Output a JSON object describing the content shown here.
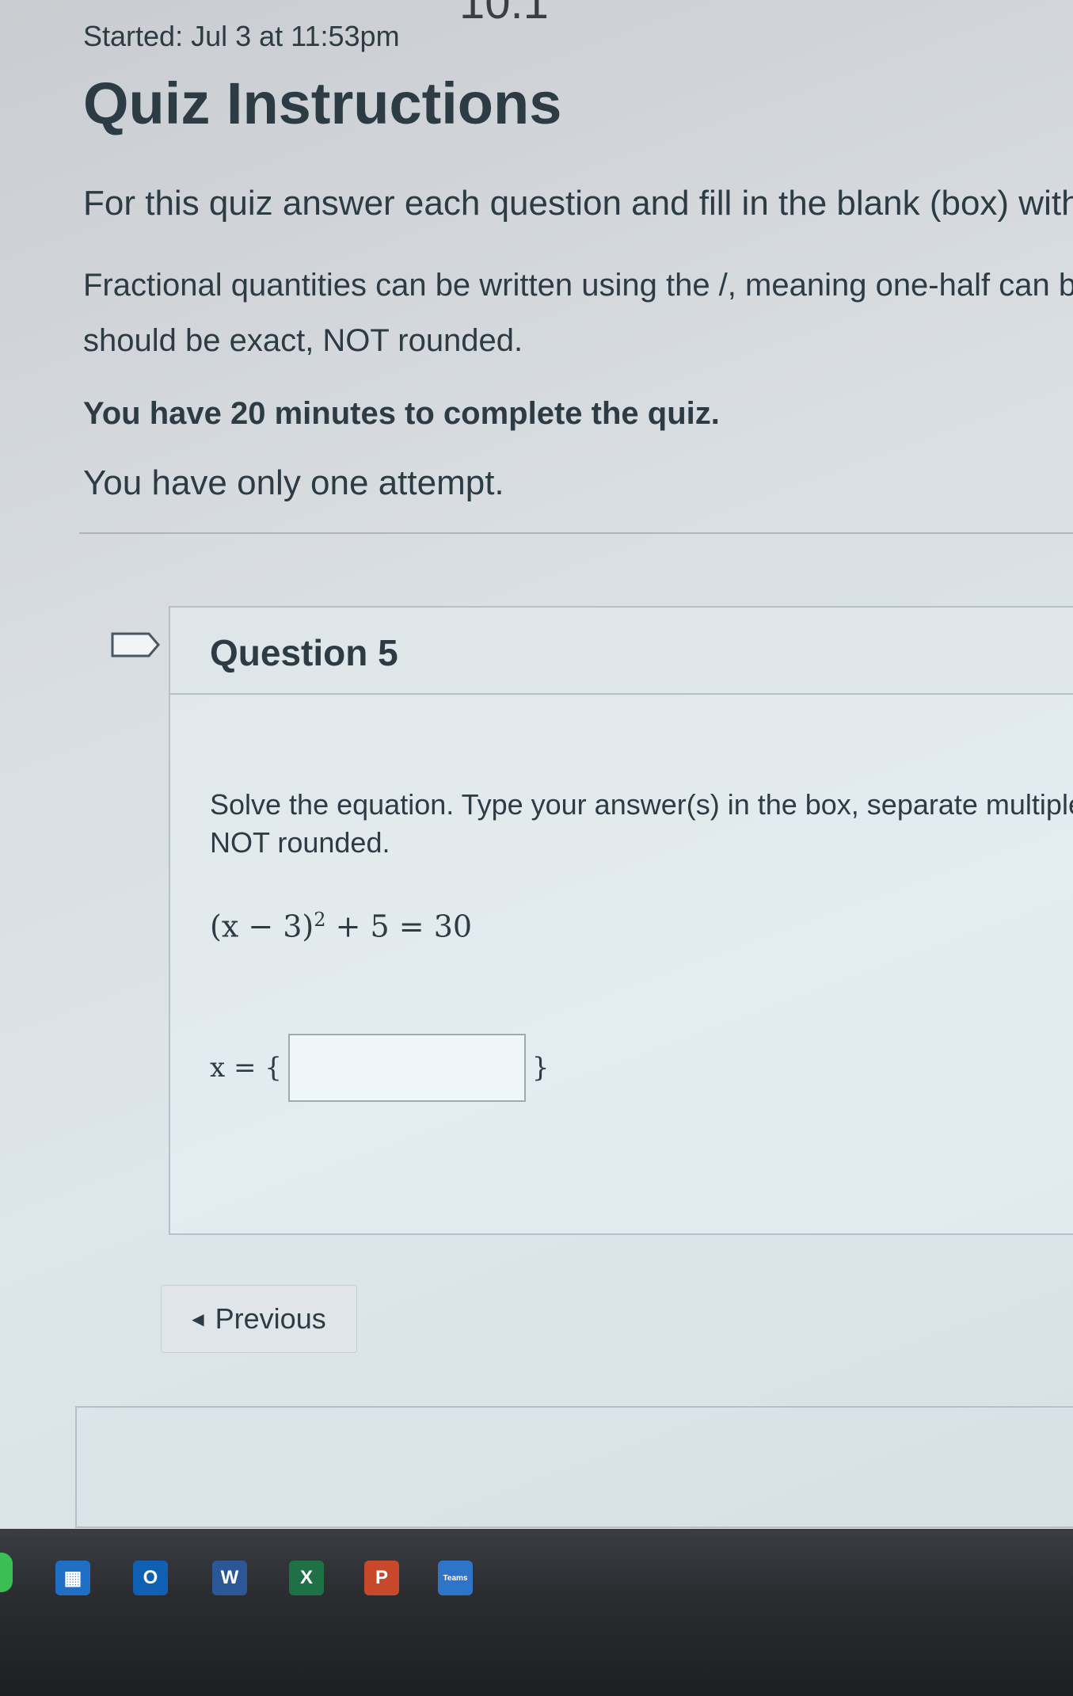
{
  "page": {
    "top_fragment": "10.1",
    "started": "Started: Jul 3 at 11:53pm",
    "title": "Quiz Instructions",
    "instructions": [
      "For this quiz answer each question and fill in the blank (box) with the",
      "Fractional quantities can be written using the /, meaning one-half can be typed a",
      "should be exact, NOT rounded.",
      "You have 20 minutes to complete the quiz.",
      "You have only one attempt."
    ]
  },
  "question": {
    "title": "Question 5",
    "text_line1": "Solve the equation.  Type your answer(s) in the box, separate multiple ansv",
    "text_line2": "NOT rounded.",
    "equation_base": "(x − 3)",
    "equation_exp": "2",
    "equation_rest": " + 5 = 30",
    "answer_prefix": "x = {",
    "answer_suffix": "}",
    "answer_value": ""
  },
  "nav": {
    "previous_label": "Previous"
  },
  "taskbar": {
    "outlook_letter": "O",
    "word_letter": "W",
    "excel_letter": "X",
    "ppt_letter": "P",
    "teams_label": "Teams"
  }
}
